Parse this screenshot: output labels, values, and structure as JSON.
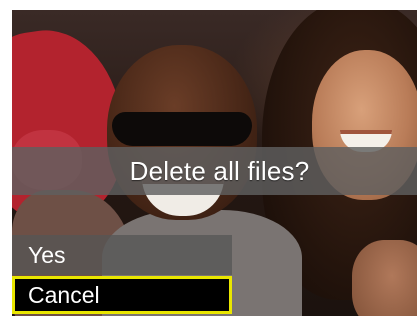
{
  "dialog": {
    "title": "Delete all files?"
  },
  "options": [
    {
      "label": "Yes",
      "selected": false
    },
    {
      "label": "Cancel",
      "selected": true
    }
  ],
  "colors": {
    "selection_border": "#e9e600",
    "selected_background": "#000000",
    "bar_background": "#5f5f5f",
    "text": "#ffffff"
  }
}
